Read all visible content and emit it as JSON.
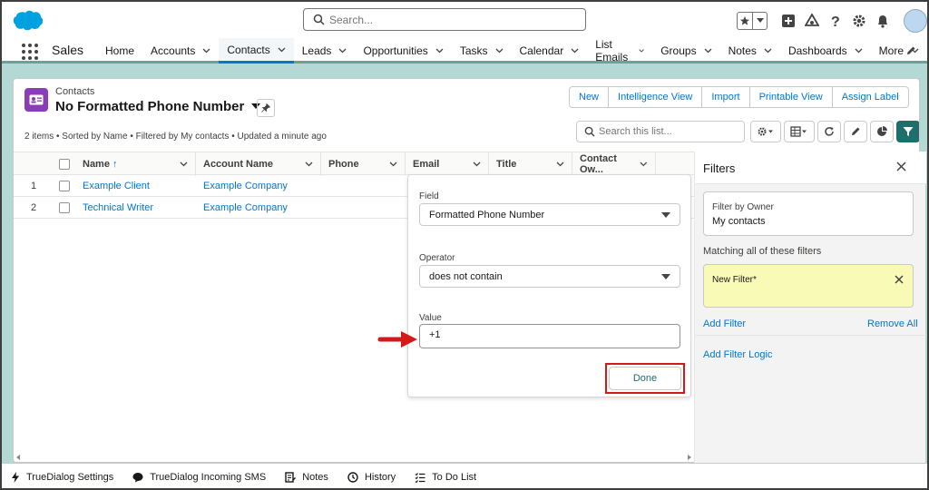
{
  "header": {
    "search_placeholder": "Search..."
  },
  "nav": {
    "app_name": "Sales",
    "items": [
      {
        "label": "Home",
        "has_menu": false
      },
      {
        "label": "Accounts",
        "has_menu": true
      },
      {
        "label": "Contacts",
        "has_menu": true,
        "active": true
      },
      {
        "label": "Leads",
        "has_menu": true
      },
      {
        "label": "Opportunities",
        "has_menu": true
      },
      {
        "label": "Tasks",
        "has_menu": true
      },
      {
        "label": "Calendar",
        "has_menu": true
      },
      {
        "label": "List Emails",
        "has_menu": true
      },
      {
        "label": "Groups",
        "has_menu": true
      },
      {
        "label": "Notes",
        "has_menu": true
      },
      {
        "label": "Dashboards",
        "has_menu": true
      },
      {
        "label": "More",
        "has_menu": true
      }
    ]
  },
  "listview": {
    "object_label": "Contacts",
    "title": "No Formatted Phone Number",
    "meta": "2 items • Sorted by Name • Filtered by My contacts • Updated a minute ago",
    "actions": [
      "New",
      "Intelligence View",
      "Import",
      "Printable View",
      "Assign Label"
    ],
    "search_placeholder": "Search this list...",
    "columns": [
      "Name",
      "Account Name",
      "Phone",
      "Email",
      "Title",
      "Contact Ow..."
    ],
    "sort_indicator": "↑",
    "rows": [
      {
        "num": "1",
        "name": "Example Client",
        "account": "Example Company"
      },
      {
        "num": "2",
        "name": "Technical Writer",
        "account": "Example Company"
      }
    ]
  },
  "filter_editor": {
    "field_label": "Field",
    "field_value": "Formatted Phone Number",
    "operator_label": "Operator",
    "operator_value": "does not contain",
    "value_label": "Value",
    "value": "+1",
    "done_label": "Done"
  },
  "filters_panel": {
    "title": "Filters",
    "owner_label": "Filter by Owner",
    "owner_value": "My contacts",
    "matching_label": "Matching all of these filters",
    "new_filter_label": "New Filter*",
    "add_filter": "Add Filter",
    "remove_all": "Remove All",
    "add_filter_logic": "Add Filter Logic"
  },
  "utility_bar": {
    "items": [
      {
        "label": "TrueDialog Settings",
        "icon": "lightning-icon"
      },
      {
        "label": "TrueDialog Incoming SMS",
        "icon": "chat-icon"
      },
      {
        "label": "Notes",
        "icon": "notes-icon"
      },
      {
        "label": "History",
        "icon": "clock-icon"
      },
      {
        "label": "To Do List",
        "icon": "todo-icon"
      }
    ]
  },
  "colors": {
    "brand_blue": "#0176d3",
    "contact_icon": "#8a3eb5",
    "band_teal": "#b4d8d4",
    "filter_active": "#1e6e6b",
    "new_filter_bg": "#fafab7",
    "highlight_red": "#d31919"
  }
}
